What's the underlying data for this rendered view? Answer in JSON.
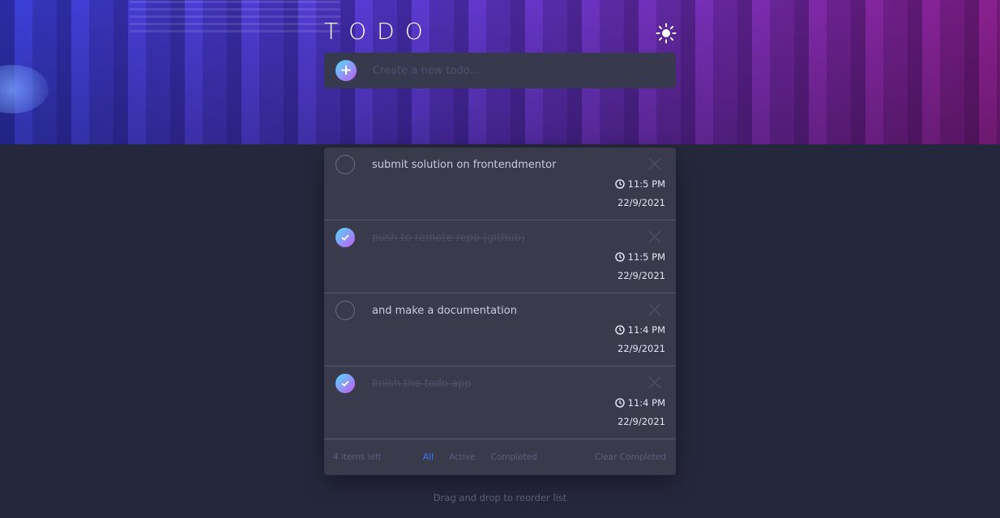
{
  "header": {
    "title": "TODO",
    "theme_icon": "sun-icon"
  },
  "create": {
    "placeholder": "Create a new todo...",
    "add_icon": "plus-icon"
  },
  "todos": [
    {
      "text": "submit solution on frontendmentor",
      "completed": false,
      "time": "11:5 PM",
      "date": "22/9/2021"
    },
    {
      "text": "push to remote repo (github)",
      "completed": true,
      "time": "11:5 PM",
      "date": "22/9/2021"
    },
    {
      "text": "and make a documentation",
      "completed": false,
      "time": "11:4 PM",
      "date": "22/9/2021"
    },
    {
      "text": "finish the todo app",
      "completed": true,
      "time": "11:4 PM",
      "date": "22/9/2021"
    }
  ],
  "footer": {
    "items_left": "4 items left",
    "filters": [
      "All",
      "Active",
      "Completed"
    ],
    "active_filter": "All",
    "clear_label": "Clear Completed"
  },
  "hint": "Drag and drop to reorder list",
  "colors": {
    "background": "#25273c",
    "card": "#393a4c",
    "accent": "#3a7bfd",
    "check_gradient": [
      "#55ddff",
      "#c058f3"
    ]
  }
}
